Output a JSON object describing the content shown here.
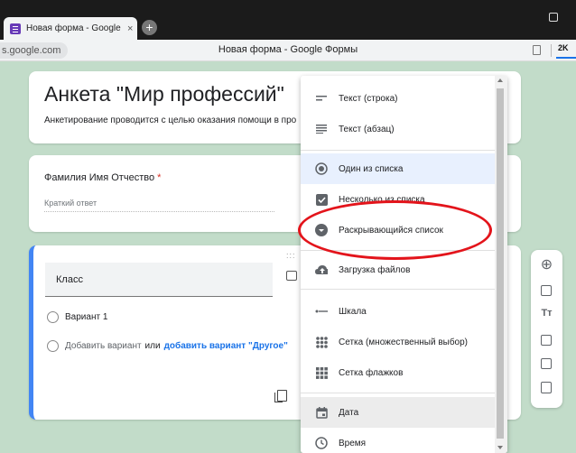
{
  "browser": {
    "tab_title": "Новая форма - Google",
    "tab_close": "×",
    "new_tab": "+",
    "url": "s.google.com",
    "page_title": "Новая форма - Google Формы",
    "badge": "2K"
  },
  "form": {
    "title": "Анкета \"Мир профессий\"",
    "description": "Анкетирование проводится с целью оказания помощи в про",
    "question1": {
      "label": "Фамилия Имя Отчество",
      "required_mark": "*",
      "placeholder": "Краткий ответ"
    },
    "question2": {
      "drag": ":::",
      "title": "Класс",
      "option1": "Вариант 1",
      "add_option": "Добавить вариант",
      "or": "или",
      "add_other": "добавить вариант \"Другое\""
    }
  },
  "sidebar": {
    "add": "⊕",
    "title_tool": "Тт"
  },
  "menu": {
    "items": [
      {
        "label": "Текст (строка)",
        "icon": "short-text-icon"
      },
      {
        "label": "Текст (абзац)",
        "icon": "paragraph-icon"
      },
      {
        "label": "Один из списка",
        "icon": "radio-icon"
      },
      {
        "label": "Несколько из списка",
        "icon": "checkbox-icon"
      },
      {
        "label": "Раскрывающийся список",
        "icon": "dropdown-icon"
      },
      {
        "label": "Загрузка файлов",
        "icon": "upload-icon"
      },
      {
        "label": "Шкала",
        "icon": "scale-icon"
      },
      {
        "label": "Сетка (множественный выбор)",
        "icon": "grid-icon"
      },
      {
        "label": "Сетка флажков",
        "icon": "checkbox-grid-icon"
      },
      {
        "label": "Дата",
        "icon": "calendar-icon"
      },
      {
        "label": "Время",
        "icon": "clock-icon"
      }
    ]
  },
  "colors": {
    "accent": "#4285f4",
    "annotation": "#e3141b",
    "background": "#c2dcc9"
  }
}
